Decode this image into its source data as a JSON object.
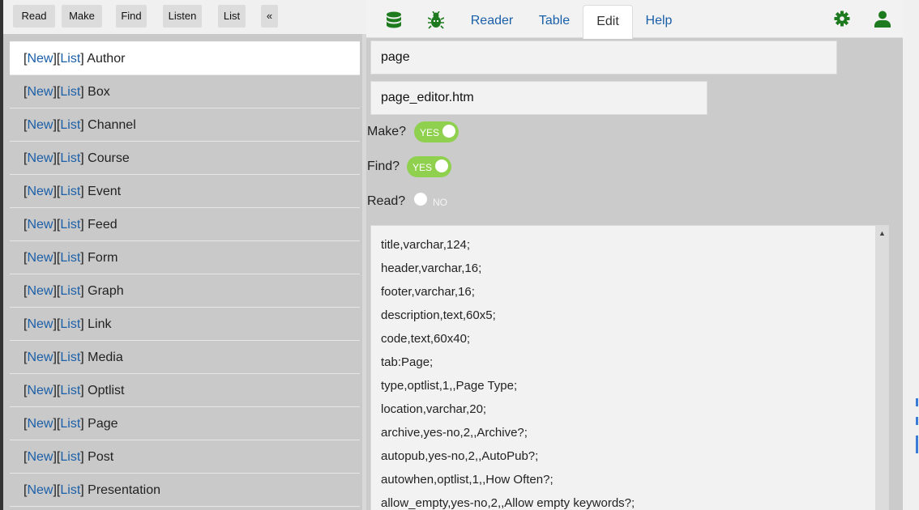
{
  "toolbar": {
    "buttons": [
      "Read",
      "Make",
      "Find",
      "Listen",
      "List",
      "«"
    ]
  },
  "entities": [
    {
      "name": "Author",
      "active": true
    },
    {
      "name": "Box"
    },
    {
      "name": "Channel"
    },
    {
      "name": "Course"
    },
    {
      "name": "Event"
    },
    {
      "name": "Feed"
    },
    {
      "name": "Form"
    },
    {
      "name": "Graph"
    },
    {
      "name": "Link"
    },
    {
      "name": "Media"
    },
    {
      "name": "Optlist"
    },
    {
      "name": "Page"
    },
    {
      "name": "Post"
    },
    {
      "name": "Presentation"
    }
  ],
  "entity_links": {
    "new": "New",
    "list": "List"
  },
  "nav": {
    "icons": [
      "database-icon",
      "bug-icon"
    ],
    "tabs": [
      "Reader",
      "Table",
      "Edit",
      "Help"
    ],
    "active_tab": "Edit",
    "right_icons": [
      "gear-icon",
      "user-icon"
    ],
    "icon_color": "#1e7a1e"
  },
  "editor": {
    "table_name": "page",
    "template_file": "page_editor.htm",
    "toggles": [
      {
        "label": "Make?",
        "state": "YES",
        "on": true
      },
      {
        "label": "Find?",
        "state": "YES",
        "on": true
      },
      {
        "label": "Read?",
        "state": "NO",
        "on": false
      }
    ],
    "schema_lines": [
      "title,varchar,124;",
      "header,varchar,16;",
      "footer,varchar,16;",
      "description,text,60x5;",
      "code,text,60x40;",
      "tab:Page;",
      "type,optlist,1,,Page Type;",
      "location,varchar,20;",
      "archive,yes-no,2,,Archive?;",
      "autopub,yes-no,2,,AutoPub?;",
      "autowhen,optlist,1,,How Often?;",
      "allow_empty,yes-no,2,,Allow empty keywords?;"
    ]
  },
  "colors": {
    "link": "#1a5fa8",
    "toggle_on": "#8fd14f",
    "active_row": "#ffffff"
  }
}
